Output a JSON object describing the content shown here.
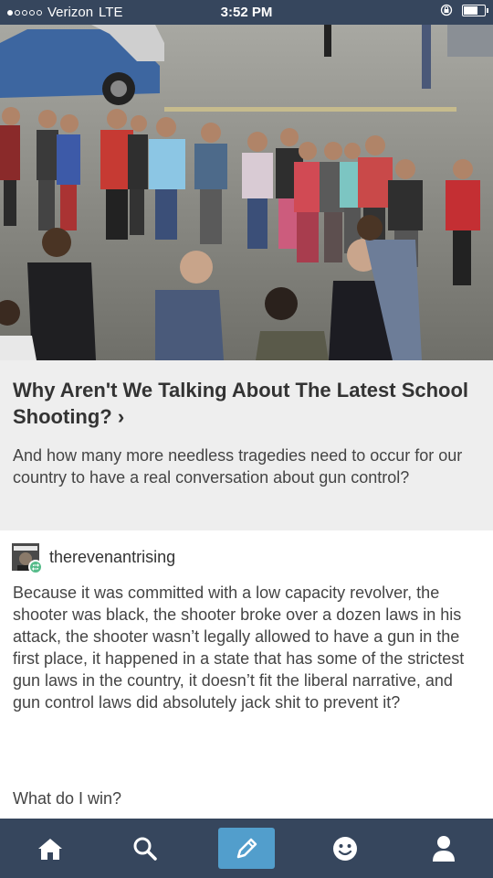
{
  "status_bar": {
    "carrier": "Verizon",
    "network": "LTE",
    "time": "3:52 PM",
    "signal_bars": 1,
    "battery_level": 0.7
  },
  "article": {
    "title": "Why Aren't We Talking About The Latest School Shooting?",
    "arrow": "›",
    "subtitle": "And how many more needless tragedies need to occur for our country to have a real conversation about gun control?"
  },
  "post": {
    "username": "therevenantrising",
    "body": "Because it was committed with a low capacity revolver, the shooter was black, the shooter broke over a dozen laws in his attack, the shooter wasn’t legally allowed to have a gun in the first place, it happened in a state that has some of the strictest gun laws in the country, it doesn’t fit the liberal narrative, and gun control laws did absolutely jack shit to prevent it?",
    "closing": "What do I win?"
  },
  "tab_bar": {
    "tabs": [
      "home-icon",
      "search-icon",
      "compose-icon",
      "activity-icon",
      "account-icon"
    ],
    "active": "compose-icon"
  },
  "colors": {
    "nav_bg": "#36465d",
    "accent": "#529ecc",
    "reblog_green": "#56bc8a"
  }
}
